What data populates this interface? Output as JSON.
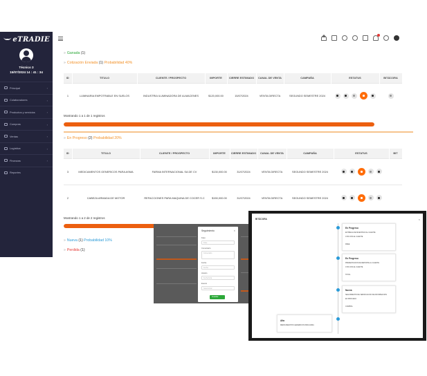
{
  "brand": {
    "logo_text": "eTRADIE"
  },
  "user": {
    "name": "Técnico 3",
    "datetime": "15/07/2024 14 : 41 : 34"
  },
  "sidebar": {
    "items": [
      {
        "label": "Principal"
      },
      {
        "label": "Colaboradores"
      },
      {
        "label": "Productos y servicios"
      },
      {
        "label": "Compras"
      },
      {
        "label": "Ventas"
      },
      {
        "label": "Logística"
      },
      {
        "label": "Finanzas"
      },
      {
        "label": "Reportes"
      }
    ]
  },
  "stages": {
    "ganada": {
      "name": "Ganada",
      "count": "(1)"
    },
    "cotizacion": {
      "name": "Cotización Enviada",
      "count": "(1)",
      "prob": "Probabilidad 40%"
    },
    "progreso": {
      "name": "En Progreso",
      "count": "(2)",
      "prob": "Probabilidad 20%"
    },
    "nueva": {
      "name": "Nueva",
      "count": "(1)",
      "prob": "Probabilidad 10%"
    },
    "perdida": {
      "name": "Perdida",
      "count": "(1)"
    }
  },
  "table1": {
    "headers": [
      "ID",
      "TITULO",
      "CLIENTE / PROSPECTO",
      "IMPORTE",
      "CIERRE ESTIMADO",
      "CANAL DE VENTA",
      "CAMPAÑA",
      "ESTATUS",
      "BITÁCORA"
    ],
    "rows": [
      [
        "1",
        "LUMINARIA EMPOTRABLE EN SUELOS",
        "INDUSTRIA ILUMINADORA DE ALMACENES",
        "$120,000.00",
        "15/07/2024",
        "VENTA DIRECTA",
        "SEGUNDO SEMESTRE 2024"
      ]
    ],
    "showing": "Mostrando 1 a 1 de 1 registros",
    "progress": 1.0
  },
  "table2": {
    "headers": [
      "ID",
      "TITULO",
      "CLIENTE / PROSPECTO",
      "IMPORTE",
      "CIERRE ESTIMADO",
      "CANAL DE VENTA",
      "CAMPAÑA",
      "ESTATUS",
      "BIT"
    ],
    "rows": [
      [
        "3",
        "MEDICAMENTOS GENERICOS PARA ASMA",
        "FARMA INTERNACIONAL SA DE CV",
        "$130,000.00",
        "31/07/2024",
        "VENTA DIRECTA",
        "SEGUNDO SEMESTRE 2024"
      ],
      [
        "2",
        "CABEZA ARMADA DE MOTOR",
        "REFACCIONES PARA MAQUINA DE COCER S.C",
        "$150,000.00",
        "31/07/2024",
        "VENTA DIRECTA",
        "SEGUNDO SEMESTRE 2024"
      ]
    ],
    "showing": "Mostrando 1 a 2 de 2 registros",
    "progress": 1.0
  },
  "modal": {
    "title": "Seguimiento",
    "fields": [
      "Fase",
      "Comentario",
      "Fecha",
      "Fecha hora",
      "Seleccionar"
    ],
    "field_labels": [
      "Fase",
      "Comentario",
      "Fecha",
      "Horario",
      "Evento"
    ],
    "button": "Guardar"
  },
  "timeline": {
    "title": "BITÁCORA",
    "cards": [
      {
        "stage": "En Progreso",
        "lines": [
          "ENTREGA DE MUESTRAS AL CLIENTE",
          "CITA CON EL CLIENTE"
        ],
        "meta": "FREE"
      },
      {
        "stage": "En Progreso",
        "lines": [
          "PRESENTACION DE REPORTE AL CLIENTE",
          "CITA CON EL CLIENTE"
        ],
        "meta": "TOTAL"
      },
      {
        "stage": "Nueva",
        "lines": [
          "SEGUIMIENTO DE VERIFICACION DE INFORMACION",
          "EN PROCESO"
        ],
        "meta": "COMPRA"
      },
      {
        "stage": "Alta",
        "lines": [
          "MEDICAMENTOS GENERICOS PARA ASMA"
        ],
        "meta": ""
      }
    ]
  },
  "colors": {
    "accent": "#ff6d0a",
    "sidebar": "#23243b",
    "green": "#2ca839",
    "orange": "#f29128",
    "red": "#e53935",
    "blue": "#2b9bd8"
  }
}
